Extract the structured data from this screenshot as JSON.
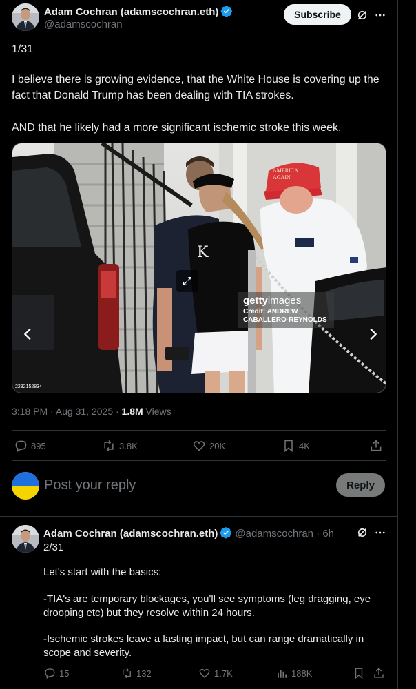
{
  "main_tweet": {
    "author_name": "Adam Cochran (adamscochran.eth)",
    "author_handle": "@adamscochran",
    "subscribe_label": "Subscribe",
    "text_line_1": "1/31",
    "text_line_2": "I believe there is growing evidence, that the White House is covering up the fact that Donald Trump has been dealing with TIA strokes.",
    "text_line_3": "AND that he likely had a more significant ischemic stroke this week.",
    "media": {
      "watermark_brand": "getty",
      "watermark_suffix": "images",
      "credit_line_1": "Credit: ANDREW",
      "credit_line_2": "CABALLERO-REYNOLDS",
      "image_id": "2232152834",
      "cap_text_1": "AMERICA",
      "cap_text_2": "AGAIN"
    },
    "timestamp": "3:18 PM · Aug 31, 2025 · ",
    "views_count": "1.8M",
    "views_label": " Views",
    "actions": {
      "replies": "895",
      "reposts": "3.8K",
      "likes": "20K",
      "bookmarks": "4K"
    }
  },
  "composer": {
    "placeholder": "Post your reply",
    "reply_label": "Reply"
  },
  "reply_tweet": {
    "author_name": "Adam Cochran (adamscochran.eth)",
    "author_handle": "@adamscochran · 6h",
    "text_line_1": "2/31",
    "text_line_2": "Let's start with the basics:",
    "text_line_3": "-TIA's are temporary blockages, you'll see symptoms (leg dragging, eye drooping etc) but they resolve within 24 hours.",
    "text_line_4": "-Ischemic strokes leave a lasting impact, but can range dramatically in scope and severity.",
    "actions": {
      "replies": "15",
      "reposts": "132",
      "likes": "1.7K",
      "views": "188K"
    }
  },
  "colors": {
    "background": "#000000",
    "text_primary": "#e7e9ea",
    "text_secondary": "#71767b",
    "verified": "#1d9bf0",
    "divider": "#2f3336"
  }
}
